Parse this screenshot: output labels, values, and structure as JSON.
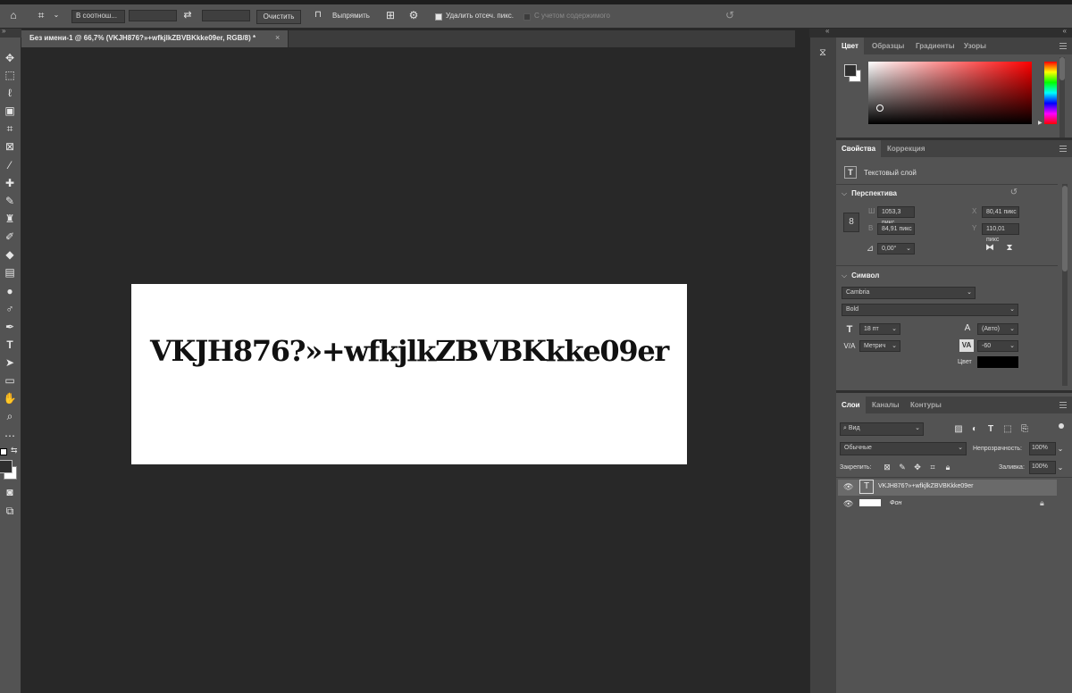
{
  "options_bar": {
    "ratio_select": "В соотнош...",
    "clear_button": "Очистить",
    "straighten_label": "Выпрямить",
    "delete_cropped_label": "Удалить отсеч. пикс.",
    "content_aware_label": "С учетом содержимого"
  },
  "document": {
    "tab_title": "Без имени-1 @ 66,7% (VKJH876?»+wfkjlkZBVBKkke09er, RGB/8) *",
    "tab_close": "×",
    "canvas_text": "VKJH876?»+wfkjlkZBVBKkke09er"
  },
  "color_panel": {
    "tabs": [
      "Цвет",
      "Образцы",
      "Градиенты",
      "Узоры"
    ]
  },
  "properties_panel": {
    "tabs": [
      "Свойства",
      "Коррекция"
    ],
    "layer_type": "Текстовый слой",
    "perspective_title": "Перспектива",
    "w_label": "Ш",
    "w_value": "1053,3 пикс",
    "h_label": "В",
    "h_value": "84,91 пикс",
    "x_label": "X",
    "x_value": "80,41 пикс",
    "y_label": "Y",
    "y_value": "110,01 пикс",
    "angle_value": "0,00°",
    "symbol_title": "Символ",
    "font_family": "Cambria",
    "font_style": "Bold",
    "font_size": "18 пт",
    "leading": "(Авто)",
    "kerning": "Метрич",
    "tracking": "-60",
    "color_label": "Цвет",
    "text_color": "#000000"
  },
  "layers_panel": {
    "tabs": [
      "Слои",
      "Каналы",
      "Контуры"
    ],
    "filter_kind": "Вид",
    "blend_mode": "Обычные",
    "opacity_label": "Непрозрачность:",
    "opacity_value": "100%",
    "lock_label": "Закрепить:",
    "fill_label": "Заливка:",
    "fill_value": "100%",
    "layers": [
      {
        "name": "VKJH876?»+wfkjlkZBVBKkke09er",
        "type": "text"
      },
      {
        "name": "Фон",
        "type": "background"
      }
    ]
  },
  "colors": {
    "foreground": "#2f2f2f",
    "background": "#ffffff",
    "picker_hue": "#ff0000",
    "selected_layer_bg": "#6a6a6a"
  }
}
